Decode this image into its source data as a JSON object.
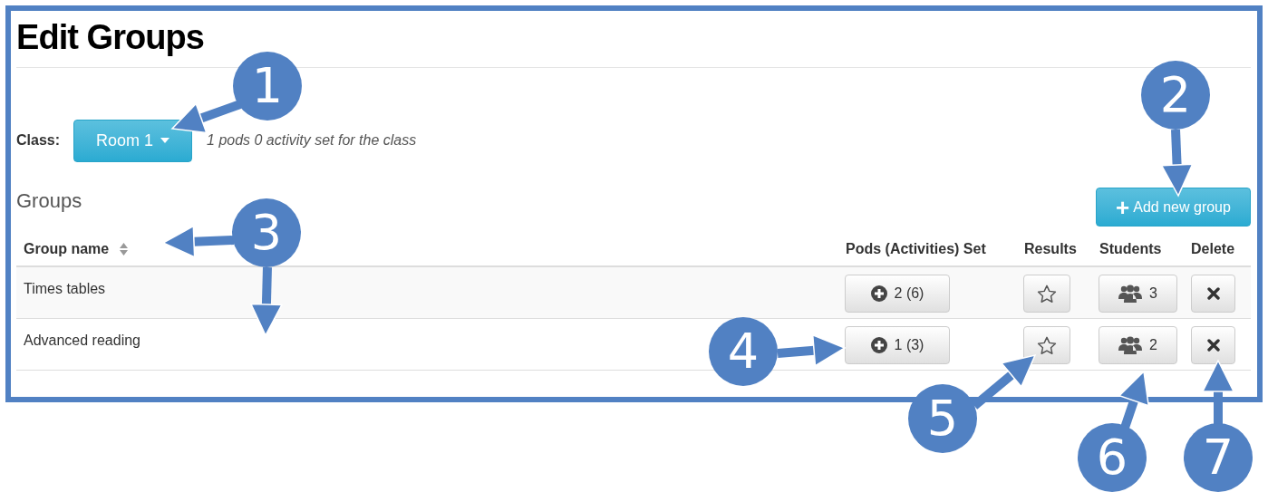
{
  "title": "Edit Groups",
  "class_label": "Class:",
  "class_dropdown": {
    "value": "Room 1"
  },
  "class_info": "1 pods 0 activity set for the class",
  "groups_heading": "Groups",
  "add_button": {
    "icon": "+",
    "label": "Add new group"
  },
  "table": {
    "columns": [
      "Group name",
      "Pods (Activities) Set",
      "Results",
      "Students",
      "Delete"
    ],
    "rows": [
      {
        "name": "Times tables",
        "pods": "2 (6)",
        "students": "3"
      },
      {
        "name": "Advanced reading",
        "pods": "1 (3)",
        "students": "2"
      }
    ]
  },
  "callouts": [
    "1",
    "2",
    "3",
    "4",
    "5",
    "6",
    "7"
  ]
}
